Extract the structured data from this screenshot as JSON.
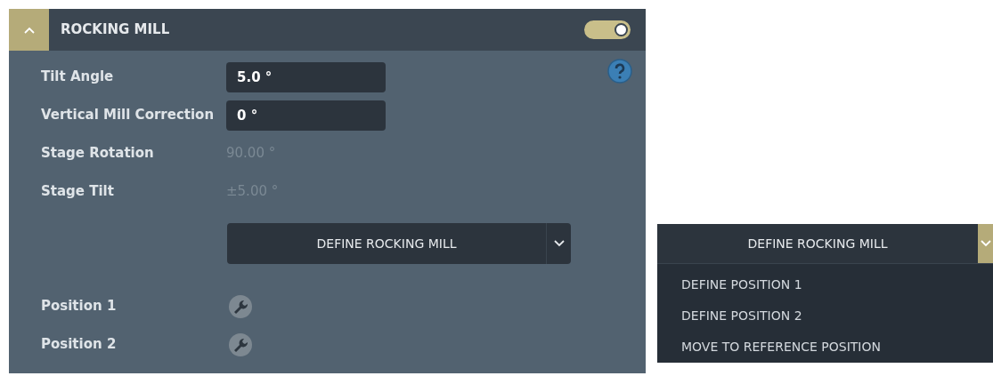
{
  "panel": {
    "title": "ROCKING MILL",
    "expanded": true,
    "enabled": true
  },
  "fields": [
    {
      "kind": "input",
      "label": "Tilt Angle",
      "value": "5.0 °"
    },
    {
      "kind": "input",
      "label": "Vertical Mill Correction",
      "value": "0 °"
    },
    {
      "kind": "readonly",
      "label": "Stage Rotation",
      "value": "90.00 °"
    },
    {
      "kind": "readonly",
      "label": "Stage Tilt",
      "value": "±5.00 °"
    }
  ],
  "split_button": {
    "label": "DEFINE ROCKING MILL",
    "open": false
  },
  "positions": [
    {
      "label": "Position 1"
    },
    {
      "label": "Position 2"
    }
  ],
  "dropdown": {
    "label": "DEFINE ROCKING MILL",
    "open": true,
    "items": [
      {
        "label": "DEFINE POSITION 1"
      },
      {
        "label": "DEFINE POSITION 2"
      },
      {
        "label": "MOVE TO REFERENCE POSITION"
      }
    ]
  }
}
